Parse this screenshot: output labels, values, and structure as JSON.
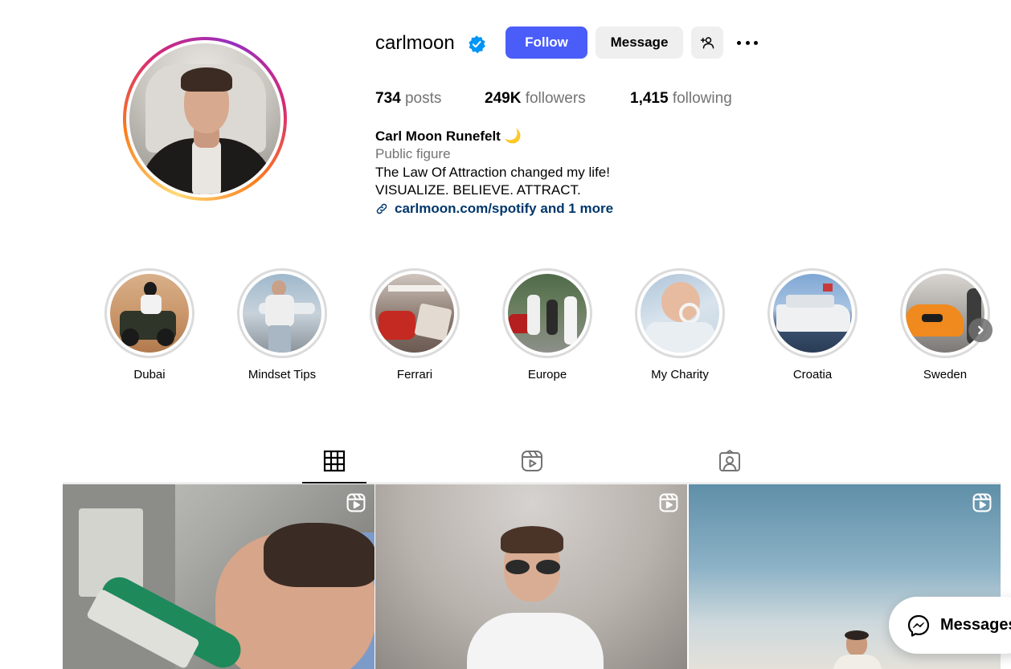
{
  "profile": {
    "username": "carlmoon",
    "verified": true,
    "buttons": {
      "follow": "Follow",
      "message": "Message"
    },
    "stats": {
      "posts_count": "734",
      "posts_label": "posts",
      "followers_count": "249K",
      "followers_label": "followers",
      "following_count": "1,415",
      "following_label": "following"
    },
    "bio": {
      "full_name": "Carl Moon Runefelt 🌙",
      "category": "Public figure",
      "line1": "The Law Of Attraction changed my life!",
      "line2": "VISUALIZE. BELIEVE. ATTRACT.",
      "link": "carlmoon.com/spotify and 1 more"
    }
  },
  "highlights": [
    {
      "label": "Dubai"
    },
    {
      "label": "Mindset Tips"
    },
    {
      "label": "Ferrari"
    },
    {
      "label": "Europe"
    },
    {
      "label": "My Charity"
    },
    {
      "label": "Croatia"
    },
    {
      "label": "Sweden"
    }
  ],
  "tabs": [
    {
      "name": "posts-grid",
      "icon": "grid-icon",
      "active": true
    },
    {
      "name": "reels",
      "icon": "reels-icon",
      "active": false
    },
    {
      "name": "tagged",
      "icon": "tagged-icon",
      "active": false
    }
  ],
  "posts": [
    {
      "type": "reel",
      "icon": "reel-icon"
    },
    {
      "type": "reel",
      "icon": "reel-icon"
    },
    {
      "type": "reel",
      "icon": "reel-icon"
    }
  ],
  "messages_button": {
    "label": "Messages",
    "icon": "messenger-icon"
  },
  "colors": {
    "accent_blue": "#4a5df9",
    "verified_blue": "#0095f6",
    "link_blue": "#00376b",
    "secondary_text": "#737373"
  }
}
